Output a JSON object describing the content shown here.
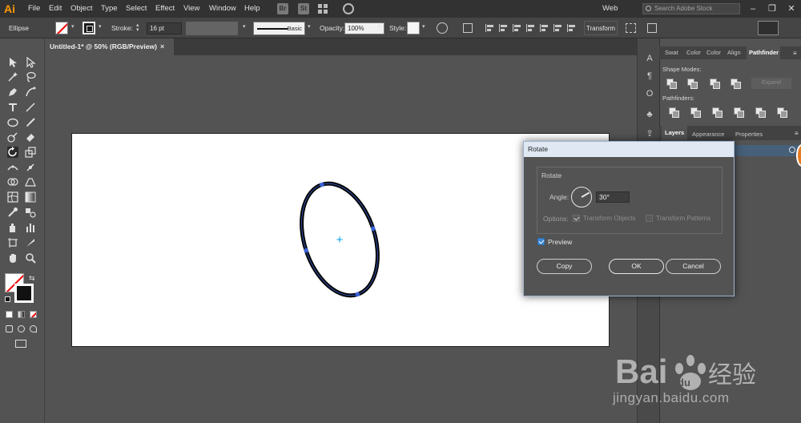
{
  "app": {
    "logo_text": "Ai"
  },
  "menu": [
    "File",
    "Edit",
    "Object",
    "Type",
    "Select",
    "Effect",
    "View",
    "Window",
    "Help"
  ],
  "app_buttons": [
    "Br",
    "St"
  ],
  "workspace": "Web",
  "search": {
    "placeholder": "Search Adobe Stock"
  },
  "window_controls": [
    "–",
    "❐",
    "✕"
  ],
  "control_bar": {
    "selection": "Ellipse",
    "stroke_label": "Stroke:",
    "stroke_value": "16 pt",
    "brush_label": "Basic",
    "opacity_label": "Opacity:",
    "opacity_value": "100%",
    "style_label": "Style:",
    "transform_label": "Transform"
  },
  "document": {
    "tab_title": "Untitled-1* @ 50% (RGB/Preview)",
    "close": "×"
  },
  "panels": {
    "top_tabs": [
      "Swat",
      "Color",
      "Color",
      "Align",
      "Pathfinder"
    ],
    "shape_modes_label": "Shape Modes:",
    "expand_label": "Expand",
    "pathfinders_label": "Pathfinders:",
    "bottom_tabs": [
      "Layers",
      "Appearance",
      "Properties"
    ]
  },
  "rotate_dialog": {
    "title": "Rotate",
    "group_label": "Rotate",
    "angle_label": "Angle:",
    "angle_value": "30°",
    "options_label": "Options:",
    "transform_objects": "Transform Objects",
    "transform_patterns": "Transform Patterns",
    "preview": "Preview",
    "copy": "Copy",
    "ok": "OK",
    "cancel": "Cancel"
  },
  "watermark": {
    "brand": "Bai du 经验",
    "url": "jingyan.baidu.com"
  },
  "colors": {
    "accent": "#3c8ad8",
    "selection_blue": "#3a63d6",
    "logo_orange": "#ff9a00"
  }
}
